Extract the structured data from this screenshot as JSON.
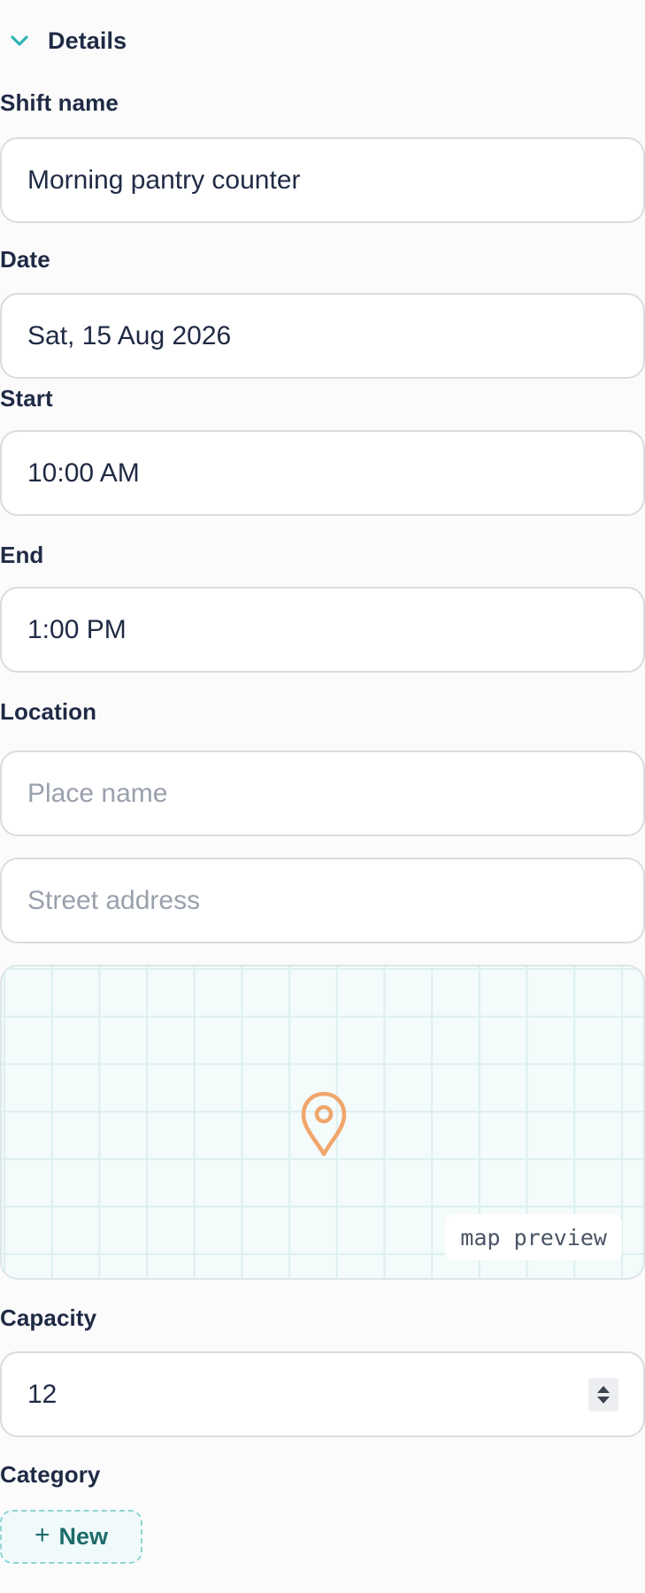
{
  "section": {
    "title": "Details",
    "expanded": true,
    "chevron_icon": "chevron-down-icon",
    "accent_color": "#2fb5b5"
  },
  "fields": {
    "shift_name": {
      "label": "Shift name",
      "value": "Morning pantry counter"
    },
    "date": {
      "label": "Date",
      "value": "Sat, 15 Aug 2026"
    },
    "start": {
      "label": "Start",
      "value": "10:00 AM"
    },
    "end": {
      "label": "End",
      "value": "1:00 PM"
    },
    "location": {
      "label": "Location",
      "place_placeholder": "Place name",
      "street_placeholder": "Street address"
    },
    "capacity": {
      "label": "Capacity",
      "value": "12",
      "stepper_icon": "up-down-stepper-icon"
    },
    "category": {
      "label": "Category",
      "new_button_label": "New",
      "plus_icon": "plus-icon"
    }
  },
  "map": {
    "tag": "map preview",
    "pin_icon": "map-pin-icon",
    "pin_color": "#f0a56b",
    "grid_color": "#dcefef",
    "background_color": "#f4fbfb"
  },
  "colors": {
    "text": "#1f2a44",
    "placeholder": "#9aa1ad",
    "border": "#d9dce1",
    "chip_text": "#1d6b6b",
    "chip_border": "#8fd4d4"
  }
}
